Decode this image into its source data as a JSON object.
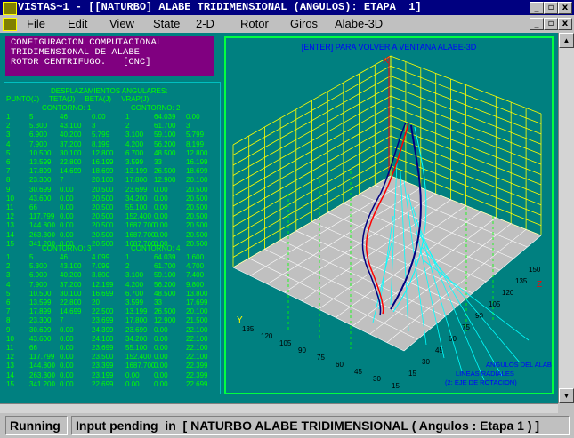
{
  "window": {
    "title": "VISTAS~1 - [[NATURBO] ALABE TRIDIMENSIONAL (ANGULOS): ETAPA  1]",
    "min_label": "_",
    "max_label": "▫",
    "close_label": "x"
  },
  "menu": {
    "items": [
      "File",
      "Edit",
      "View",
      "State",
      "2-D",
      "Rotor",
      "Giros",
      "Alabe-3D"
    ]
  },
  "config_box": {
    "lines": [
      "CONFIGURACION COMPUTACIONAL",
      "TRIDIMENSIONAL DE ALABE",
      "ROTOR CENTRIFUGO.   [CNC]"
    ]
  },
  "data_panel": {
    "heading": "DESPLAZAMIENTOS ANGULARES:",
    "col_headers": "PUNTO(J)     TETA(J)     BETA(J)     VRAP(J)",
    "contorno_1": "CONTORNO: 1",
    "contorno_2": "CONTORNO: 2",
    "contorno_3": "CONTORNO: 3",
    "contorno_4": "CONTORNO: 4",
    "rows_a": [
      [
        "1",
        "5",
        "46",
        "0.00",
        "1",
        "64.039",
        "0.00"
      ],
      [
        "2",
        "5.300",
        "43.100",
        "3",
        "2",
        "61.700",
        "3"
      ],
      [
        "3",
        "6.900",
        "40.200",
        "5.799",
        "3.100",
        "59.100",
        "5.799"
      ],
      [
        "4",
        "7.900",
        "37.200",
        "8.199",
        "4.200",
        "56.200",
        "8.199"
      ],
      [
        "5",
        "10.500",
        "30.100",
        "12.800",
        "6.700",
        "48.500",
        "12.800"
      ],
      [
        "6",
        "13.599",
        "22.800",
        "16.199",
        "3.599",
        "33",
        "16.199"
      ],
      [
        "7",
        "17.899",
        "14.699",
        "18.699",
        "13.199",
        "26.500",
        "18.699"
      ],
      [
        "8",
        "23.300",
        "7",
        "20.100",
        "17.800",
        "12.900",
        "20.100"
      ],
      [
        "9",
        "30.699",
        "0.00",
        "20.500",
        "23.699",
        "0.00",
        "20.500"
      ],
      [
        "10",
        "43.600",
        "0.00",
        "20.500",
        "34.200",
        "0.00",
        "20.500"
      ],
      [
        "11",
        "66",
        "0.00",
        "20.500",
        "55.100",
        "0.00",
        "20.500"
      ],
      [
        "12",
        "117.799",
        "0.00",
        "20.500",
        "152.400",
        "0.00",
        "20.500"
      ],
      [
        "13",
        "144.800",
        "0.00",
        "20.500",
        "1687.700",
        "0.00",
        "20.500"
      ],
      [
        "14",
        "263.300",
        "0.00",
        "20.500",
        "1687.700",
        "0.00",
        "20.500"
      ],
      [
        "15",
        "341.200",
        "0.00",
        "20.500",
        "1687.700",
        "0.00",
        "20.500"
      ]
    ],
    "rows_b": [
      [
        "1",
        "5",
        "46",
        "4.099",
        "1",
        "64.039",
        "1.600"
      ],
      [
        "2",
        "5.300",
        "43.100",
        "7.099",
        "2",
        "61.700",
        "4.700"
      ],
      [
        "3",
        "6.900",
        "40.200",
        "3.800",
        "3.100",
        "59.100",
        "7.400"
      ],
      [
        "4",
        "7.900",
        "37.200",
        "12.199",
        "4.200",
        "56.200",
        "9.800"
      ],
      [
        "5",
        "10.500",
        "30.100",
        "16.699",
        "6.700",
        "48.500",
        "13.800"
      ],
      [
        "6",
        "13.599",
        "22.800",
        "20",
        "3.599",
        "33",
        "17.699"
      ],
      [
        "7",
        "17.899",
        "14.699",
        "22.500",
        "13.199",
        "26.500",
        "20.100"
      ],
      [
        "8",
        "23.300",
        "7",
        "23.699",
        "17.800",
        "12.900",
        "21.500"
      ],
      [
        "9",
        "30.699",
        "0.00",
        "24.399",
        "23.699",
        "0.00",
        "22.100"
      ],
      [
        "10",
        "43.600",
        "0.00",
        "24.100",
        "34.200",
        "0.00",
        "22.100"
      ],
      [
        "11",
        "66",
        "0.00",
        "23.699",
        "55.100",
        "0.00",
        "22.100"
      ],
      [
        "12",
        "117.799",
        "0.00",
        "23.500",
        "152.400",
        "0.00",
        "22.100"
      ],
      [
        "13",
        "144.800",
        "0.00",
        "23.399",
        "1687.700",
        "0.00",
        "22.399"
      ],
      [
        "14",
        "263.300",
        "0.00",
        "23.199",
        "0.00",
        "0.00",
        "22.399"
      ],
      [
        "15",
        "341.200",
        "0.00",
        "22.699",
        "0.00",
        "0.00",
        "22.699"
      ]
    ]
  },
  "plot": {
    "header": "[ENTER] PARA VOLVER A VENTANA ALABE-3D",
    "axis_x": "X",
    "axis_y": "Y",
    "axis_z": "Z",
    "y_ticks": [
      "135",
      "120",
      "105",
      "90",
      "75",
      "60",
      "45",
      "30",
      "15"
    ],
    "z_ticks": [
      "15",
      "30",
      "45",
      "60",
      "75",
      "90",
      "105",
      "120",
      "135",
      "150"
    ],
    "legend": [
      "ANGULOS DEL ALABE",
      "LINEAS RADIALES",
      "(2: EJE DE ROTACION)"
    ],
    "colors": {
      "grid": "#ffff00",
      "floor": "#c0c0c0",
      "blade_outline": "#000080",
      "blade_inner": "#ff0000",
      "radial": "#00ffff",
      "legend": "#0000ff"
    }
  },
  "status": {
    "state": "Running",
    "message": "Input pending  in  [ NATURBO ALABE TRIDIMENSIONAL ( Angulos : Etapa 1 ) ]"
  }
}
